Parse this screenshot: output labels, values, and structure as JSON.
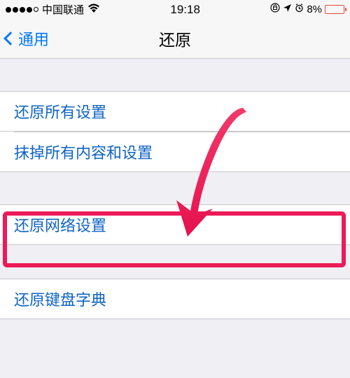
{
  "status": {
    "carrier": "中国联通",
    "time": "19:18",
    "battery": "8%"
  },
  "nav": {
    "back_label": "通用",
    "title": "还原"
  },
  "items": {
    "reset_all": "还原所有设置",
    "erase_all": "抹掉所有内容和设置",
    "reset_network": "还原网络设置",
    "reset_keyboard": "还原键盘字典"
  }
}
